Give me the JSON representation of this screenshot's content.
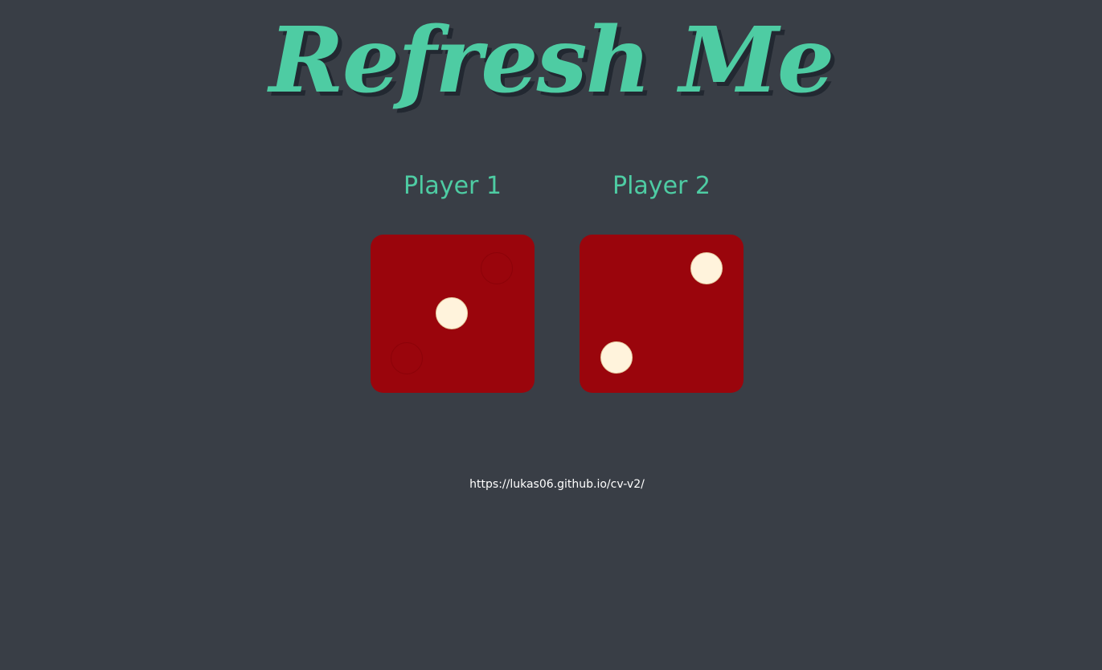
{
  "page": {
    "title": "Refresh Me",
    "footer_link": "https://lukas06.github.io/cv-v2/"
  },
  "players": [
    {
      "label": "Player 1",
      "die_value": 1
    },
    {
      "label": "Player 2",
      "die_value": 2
    }
  ],
  "colors": {
    "background": "#393e46",
    "accent": "#4ecca3",
    "title_shadow": "#222831",
    "die": "#9a050c",
    "pip": "#fff3dc",
    "link": "#ffffff"
  }
}
